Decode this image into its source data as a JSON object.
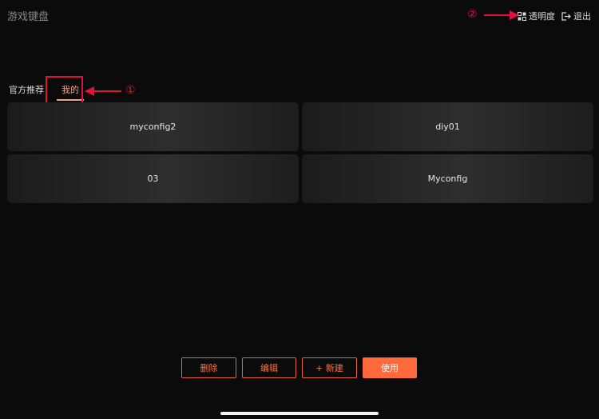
{
  "app": {
    "title": "游戏键盘"
  },
  "header": {
    "transparency_label": "透明度",
    "exit_label": "退出",
    "transparency_icon": "grid-squares-icon",
    "exit_icon": "exit-icon"
  },
  "tabs": [
    {
      "label": "官方推荐",
      "selected": false
    },
    {
      "label": "我的",
      "selected": true
    }
  ],
  "configs": [
    {
      "name": "myconfig2"
    },
    {
      "name": "diy01"
    },
    {
      "name": "03"
    },
    {
      "name": "Myconfig"
    }
  ],
  "actions": {
    "delete_label": "删除",
    "edit_label": "编辑",
    "new_label": "+ 新建",
    "use_label": "使用"
  },
  "annotations": {
    "marker_1": "①",
    "marker_2": "②",
    "color": "#e0123a"
  },
  "colors": {
    "accent": "#ff6a3d",
    "tab_selected": "#f2a488",
    "background": "#0b0b0b"
  }
}
